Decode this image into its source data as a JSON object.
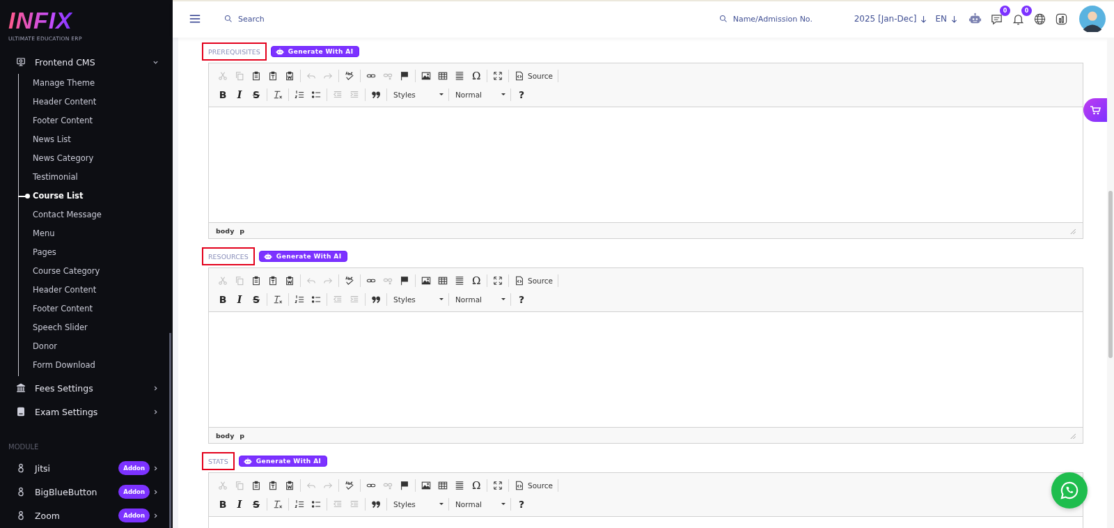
{
  "sidebar": {
    "logo": {
      "title": "INFIX",
      "tagline": "ULTIMATE EDUCATION ERP"
    },
    "menu": [
      {
        "kind": "cms",
        "label": "Frontend CMS",
        "expanded": true,
        "children": [
          {
            "label": "Manage Theme",
            "selected": false
          },
          {
            "label": "Header Content",
            "selected": false
          },
          {
            "label": "Footer Content",
            "selected": false
          },
          {
            "label": "News List",
            "selected": false
          },
          {
            "label": "News Category",
            "selected": false
          },
          {
            "label": "Testimonial",
            "selected": false
          },
          {
            "label": "Course List",
            "selected": true
          },
          {
            "label": "Contact Message",
            "selected": false
          },
          {
            "label": "Menu",
            "selected": false
          },
          {
            "label": "Pages",
            "selected": false
          },
          {
            "label": "Course Category",
            "selected": false
          },
          {
            "label": "Header Content",
            "selected": false
          },
          {
            "label": "Footer Content",
            "selected": false
          },
          {
            "label": "Speech Slider",
            "selected": false
          },
          {
            "label": "Donor",
            "selected": false
          },
          {
            "label": "Form Download",
            "selected": false
          }
        ]
      },
      {
        "kind": "fees",
        "label": "Fees Settings",
        "expanded": false
      },
      {
        "kind": "exam",
        "label": "Exam Settings",
        "expanded": false
      }
    ],
    "module_heading": "MODULE",
    "modules": [
      {
        "label": "Jitsi",
        "badge": "Addon"
      },
      {
        "label": "BigBlueButton",
        "badge": "Addon"
      },
      {
        "label": "Zoom",
        "badge": "Addon"
      }
    ]
  },
  "topbar": {
    "search": {
      "placeholder": "Search"
    },
    "student_search": {
      "placeholder": "Name/Admission No."
    },
    "session": "2025 [Jan-Dec]",
    "language": "EN",
    "chat_count": "0",
    "notification_count": "0"
  },
  "editors": [
    {
      "label": "PREREQUISITES",
      "ai_button": "Generate With AI",
      "path": [
        "body",
        "p"
      ],
      "toolbar_rows": [
        [
          {
            "kind": "cut",
            "disabled": true
          },
          {
            "kind": "copy",
            "disabled": true
          },
          {
            "kind": "paste",
            "disabled": false
          },
          {
            "kind": "pastetext",
            "disabled": false
          },
          {
            "kind": "pasteword",
            "disabled": false
          },
          {
            "kind": "sep"
          },
          {
            "kind": "undo",
            "disabled": true
          },
          {
            "kind": "redo",
            "disabled": true
          },
          {
            "kind": "sep"
          },
          {
            "kind": "spell",
            "disabled": false
          },
          {
            "kind": "sep"
          },
          {
            "kind": "link",
            "disabled": false
          },
          {
            "kind": "unlink",
            "disabled": true
          },
          {
            "kind": "anchor",
            "disabled": false
          },
          {
            "kind": "sep"
          },
          {
            "kind": "image",
            "disabled": false
          },
          {
            "kind": "table",
            "disabled": false
          },
          {
            "kind": "hr",
            "disabled": false
          },
          {
            "kind": "special",
            "text": "Ω",
            "disabled": false
          },
          {
            "kind": "sep"
          },
          {
            "kind": "maximize",
            "disabled": false
          },
          {
            "kind": "sep"
          },
          {
            "kind": "source",
            "text": "Source",
            "disabled": false
          },
          {
            "kind": "sep"
          }
        ],
        [
          {
            "kind": "bold",
            "text": "B",
            "disabled": false
          },
          {
            "kind": "italic",
            "text": "I",
            "disabled": false
          },
          {
            "kind": "strike",
            "text": "S",
            "disabled": false
          },
          {
            "kind": "sep"
          },
          {
            "kind": "removeformat",
            "disabled": false
          },
          {
            "kind": "sep"
          },
          {
            "kind": "ol",
            "disabled": false
          },
          {
            "kind": "ul",
            "disabled": false
          },
          {
            "kind": "sep"
          },
          {
            "kind": "outdent",
            "disabled": true
          },
          {
            "kind": "indent",
            "disabled": true
          },
          {
            "kind": "sep"
          },
          {
            "kind": "quote",
            "disabled": false
          },
          {
            "kind": "sep"
          },
          {
            "kind": "combo",
            "text": "Styles",
            "disabled": false
          },
          {
            "kind": "sep"
          },
          {
            "kind": "combo",
            "text": "Normal",
            "disabled": false
          },
          {
            "kind": "sep"
          },
          {
            "kind": "help",
            "text": "?",
            "disabled": false
          }
        ]
      ]
    },
    {
      "label": "RESOURCES",
      "ai_button": "Generate With AI",
      "path": [
        "body",
        "p"
      ],
      "toolbar_rows": [
        [
          {
            "kind": "cut",
            "disabled": true
          },
          {
            "kind": "copy",
            "disabled": true
          },
          {
            "kind": "paste",
            "disabled": false
          },
          {
            "kind": "pastetext",
            "disabled": false
          },
          {
            "kind": "pasteword",
            "disabled": false
          },
          {
            "kind": "sep"
          },
          {
            "kind": "undo",
            "disabled": true
          },
          {
            "kind": "redo",
            "disabled": true
          },
          {
            "kind": "sep"
          },
          {
            "kind": "spell",
            "disabled": false
          },
          {
            "kind": "sep"
          },
          {
            "kind": "link",
            "disabled": false
          },
          {
            "kind": "unlink",
            "disabled": true
          },
          {
            "kind": "anchor",
            "disabled": false
          },
          {
            "kind": "sep"
          },
          {
            "kind": "image",
            "disabled": false
          },
          {
            "kind": "table",
            "disabled": false
          },
          {
            "kind": "hr",
            "disabled": false
          },
          {
            "kind": "special",
            "text": "Ω",
            "disabled": false
          },
          {
            "kind": "sep"
          },
          {
            "kind": "maximize",
            "disabled": false
          },
          {
            "kind": "sep"
          },
          {
            "kind": "source",
            "text": "Source",
            "disabled": false
          },
          {
            "kind": "sep"
          }
        ],
        [
          {
            "kind": "bold",
            "text": "B",
            "disabled": false
          },
          {
            "kind": "italic",
            "text": "I",
            "disabled": false
          },
          {
            "kind": "strike",
            "text": "S",
            "disabled": false
          },
          {
            "kind": "sep"
          },
          {
            "kind": "removeformat",
            "disabled": false
          },
          {
            "kind": "sep"
          },
          {
            "kind": "ol",
            "disabled": false
          },
          {
            "kind": "ul",
            "disabled": false
          },
          {
            "kind": "sep"
          },
          {
            "kind": "outdent",
            "disabled": true
          },
          {
            "kind": "indent",
            "disabled": true
          },
          {
            "kind": "sep"
          },
          {
            "kind": "quote",
            "disabled": false
          },
          {
            "kind": "sep"
          },
          {
            "kind": "combo",
            "text": "Styles",
            "disabled": false
          },
          {
            "kind": "sep"
          },
          {
            "kind": "combo",
            "text": "Normal",
            "disabled": false
          },
          {
            "kind": "sep"
          },
          {
            "kind": "help",
            "text": "?",
            "disabled": false
          }
        ]
      ]
    },
    {
      "label": "STATS",
      "ai_button": "Generate With AI",
      "toolbar_rows": [
        [
          {
            "kind": "cut",
            "disabled": true
          },
          {
            "kind": "copy",
            "disabled": true
          },
          {
            "kind": "paste",
            "disabled": false
          },
          {
            "kind": "pastetext",
            "disabled": false
          },
          {
            "kind": "pasteword",
            "disabled": false
          },
          {
            "kind": "sep"
          },
          {
            "kind": "undo",
            "disabled": true
          },
          {
            "kind": "redo",
            "disabled": true
          },
          {
            "kind": "sep"
          },
          {
            "kind": "spell",
            "disabled": false
          },
          {
            "kind": "sep"
          },
          {
            "kind": "link",
            "disabled": false
          },
          {
            "kind": "unlink",
            "disabled": true
          },
          {
            "kind": "anchor",
            "disabled": false
          },
          {
            "kind": "sep"
          },
          {
            "kind": "image",
            "disabled": false
          },
          {
            "kind": "table",
            "disabled": false
          },
          {
            "kind": "hr",
            "disabled": false
          },
          {
            "kind": "special",
            "text": "Ω",
            "disabled": false
          },
          {
            "kind": "sep"
          },
          {
            "kind": "maximize",
            "disabled": false
          },
          {
            "kind": "sep"
          },
          {
            "kind": "source",
            "text": "Source",
            "disabled": false
          },
          {
            "kind": "sep"
          }
        ],
        [
          {
            "kind": "bold",
            "text": "B",
            "disabled": false
          },
          {
            "kind": "italic",
            "text": "I",
            "disabled": false
          },
          {
            "kind": "strike",
            "text": "S",
            "disabled": false
          },
          {
            "kind": "sep"
          },
          {
            "kind": "removeformat",
            "disabled": false
          },
          {
            "kind": "sep"
          },
          {
            "kind": "ol",
            "disabled": false
          },
          {
            "kind": "ul",
            "disabled": false
          },
          {
            "kind": "sep"
          },
          {
            "kind": "outdent",
            "disabled": true
          },
          {
            "kind": "indent",
            "disabled": true
          },
          {
            "kind": "sep"
          },
          {
            "kind": "quote",
            "disabled": false
          },
          {
            "kind": "sep"
          },
          {
            "kind": "combo",
            "text": "Styles",
            "disabled": false
          },
          {
            "kind": "sep"
          },
          {
            "kind": "combo",
            "text": "Normal",
            "disabled": false
          },
          {
            "kind": "sep"
          },
          {
            "kind": "help",
            "text": "?",
            "disabled": false
          }
        ]
      ]
    }
  ]
}
